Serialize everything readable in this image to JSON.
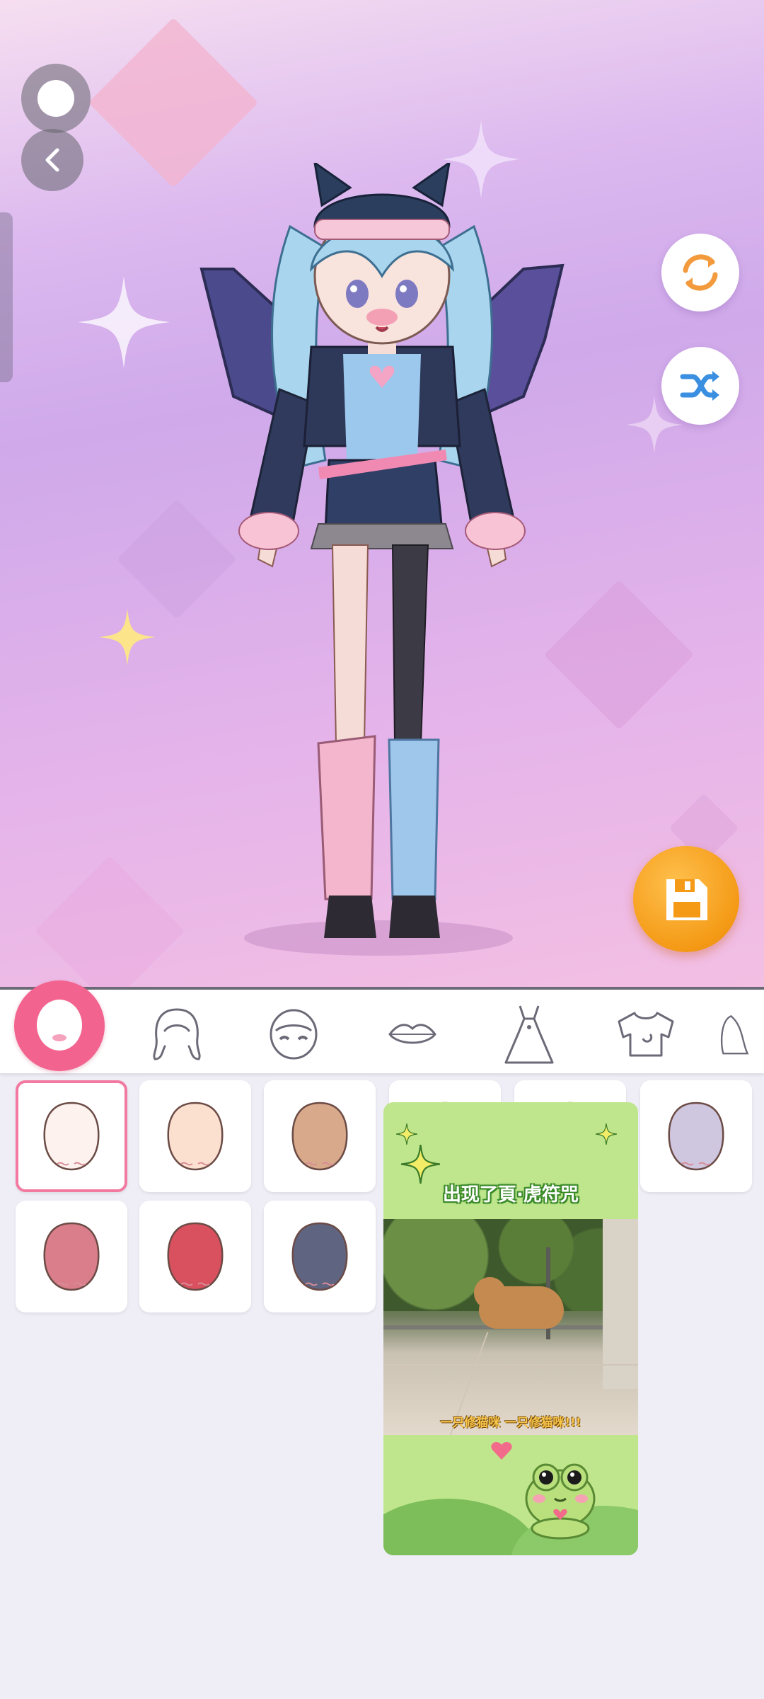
{
  "stage": {
    "top_buttons": [
      "circle-button",
      "back-button"
    ],
    "right_buttons": [
      "refresh-icon",
      "shuffle-icon"
    ],
    "save_icon": "floppy-disk-icon",
    "colors": {
      "bg_top": "#dcb9ef",
      "bg_bottom": "#f3bfe3",
      "accent": "#f49a16"
    }
  },
  "categories": {
    "items": [
      "face",
      "hair",
      "eyes",
      "lips",
      "dress",
      "top",
      "more"
    ],
    "active": "face",
    "active_color": "#f2638f"
  },
  "swatches": {
    "row1": [
      "#fdf2ee",
      "#fbe0d0",
      "#d8a98a",
      "#b78a6b",
      "#8a6a5a",
      "#cfc6e0"
    ],
    "row2": [
      "#db7e8c",
      "#d9505f",
      "#5f6481"
    ],
    "selected_index": 0
  },
  "ad": {
    "title": "出现了頁·虎符咒",
    "caption": "一只修猫咪 一只修猫咪!!!"
  }
}
